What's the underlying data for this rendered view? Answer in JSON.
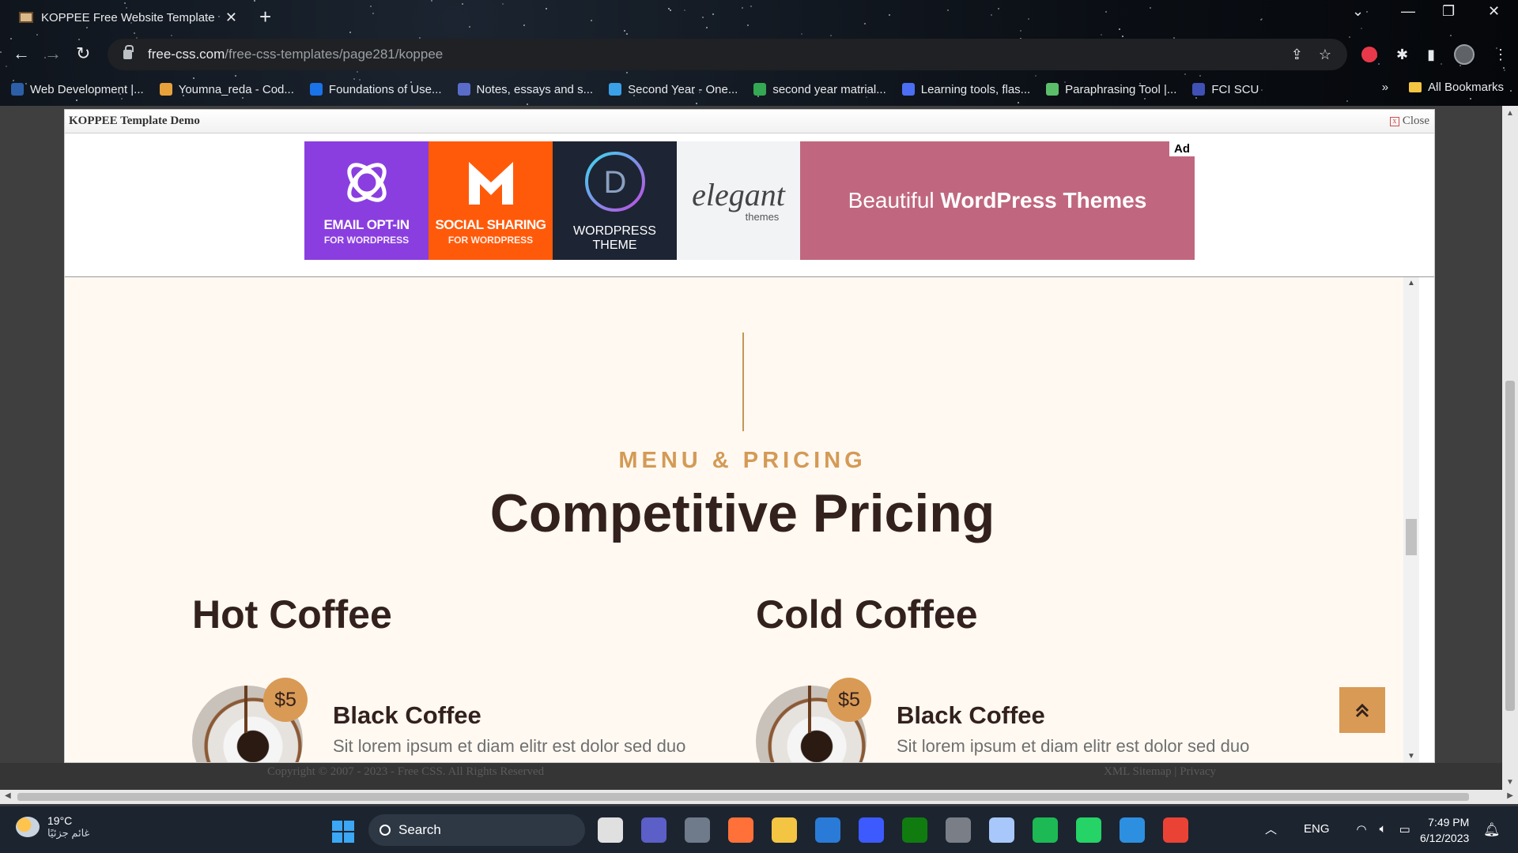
{
  "browser": {
    "tab_title": "KOPPEE Free Website Template",
    "url_host": "free-css.com",
    "url_path": "/free-css-templates/page281/koppee",
    "bookmarks": [
      "Web Development |...",
      "Youmna_reda - Cod...",
      "Foundations of Use...",
      "Notes, essays and s...",
      "Second Year - One...",
      "second year matrial...",
      "Learning tools, flas...",
      "Paraphrasing Tool |...",
      "FCI SCU"
    ],
    "bookmark_colors": [
      "#2d5fa8",
      "#e8a23b",
      "#1a73e8",
      "#5a6cc9",
      "#3aa0e8",
      "#34a853",
      "#4c6ef5",
      "#5bbf6a",
      "#3f51b5"
    ],
    "all_bookmarks": "All Bookmarks"
  },
  "frame": {
    "title": "KOPPEE Template Demo",
    "close": "Close"
  },
  "ad": {
    "label": "Ad",
    "panel1": {
      "title": "EMAIL OPT-IN",
      "sub": "FOR WORDPRESS"
    },
    "panel2": {
      "title": "SOCIAL SHARING",
      "sub": "FOR WORDPRESS"
    },
    "panel3": {
      "title": "WORDPRESS THEME"
    },
    "panel4": {
      "brand": "elegant",
      "sub": "themes"
    },
    "tagline_light": "Beautiful",
    "tagline_bold": "WordPress Themes"
  },
  "section": {
    "kicker": "MENU & PRICING",
    "heading": "Competitive Pricing",
    "columns": [
      {
        "title": "Hot Coffee",
        "item": {
          "price": "$5",
          "name": "Black Coffee",
          "desc": "Sit lorem ipsum et diam elitr est dolor sed duo"
        }
      },
      {
        "title": "Cold Coffee",
        "item": {
          "price": "$5",
          "name": "Black Coffee",
          "desc": "Sit lorem ipsum et diam elitr est dolor sed duo"
        }
      }
    ]
  },
  "page_footer": {
    "copyright": "Copyright © 2007 - 2023 - Free CSS. All Rights Reserved",
    "links": "XML Sitemap | Privacy"
  },
  "taskbar": {
    "weather_temp": "19°C",
    "weather_text": "غائم جزئيًا",
    "search_label": "Search",
    "language": "ENG",
    "time": "7:49 PM",
    "date": "6/12/2023",
    "app_colors": [
      "#e0e0e0",
      "#5b5fc7",
      "#6f7a8a",
      "#ff7139",
      "#f4c542",
      "#2a7bd8",
      "#3d5afe",
      "#107c10",
      "#7a7f87",
      "#a8c7fa",
      "#1db954",
      "#25d366",
      "#2d8fe0",
      "#ea4335"
    ]
  }
}
